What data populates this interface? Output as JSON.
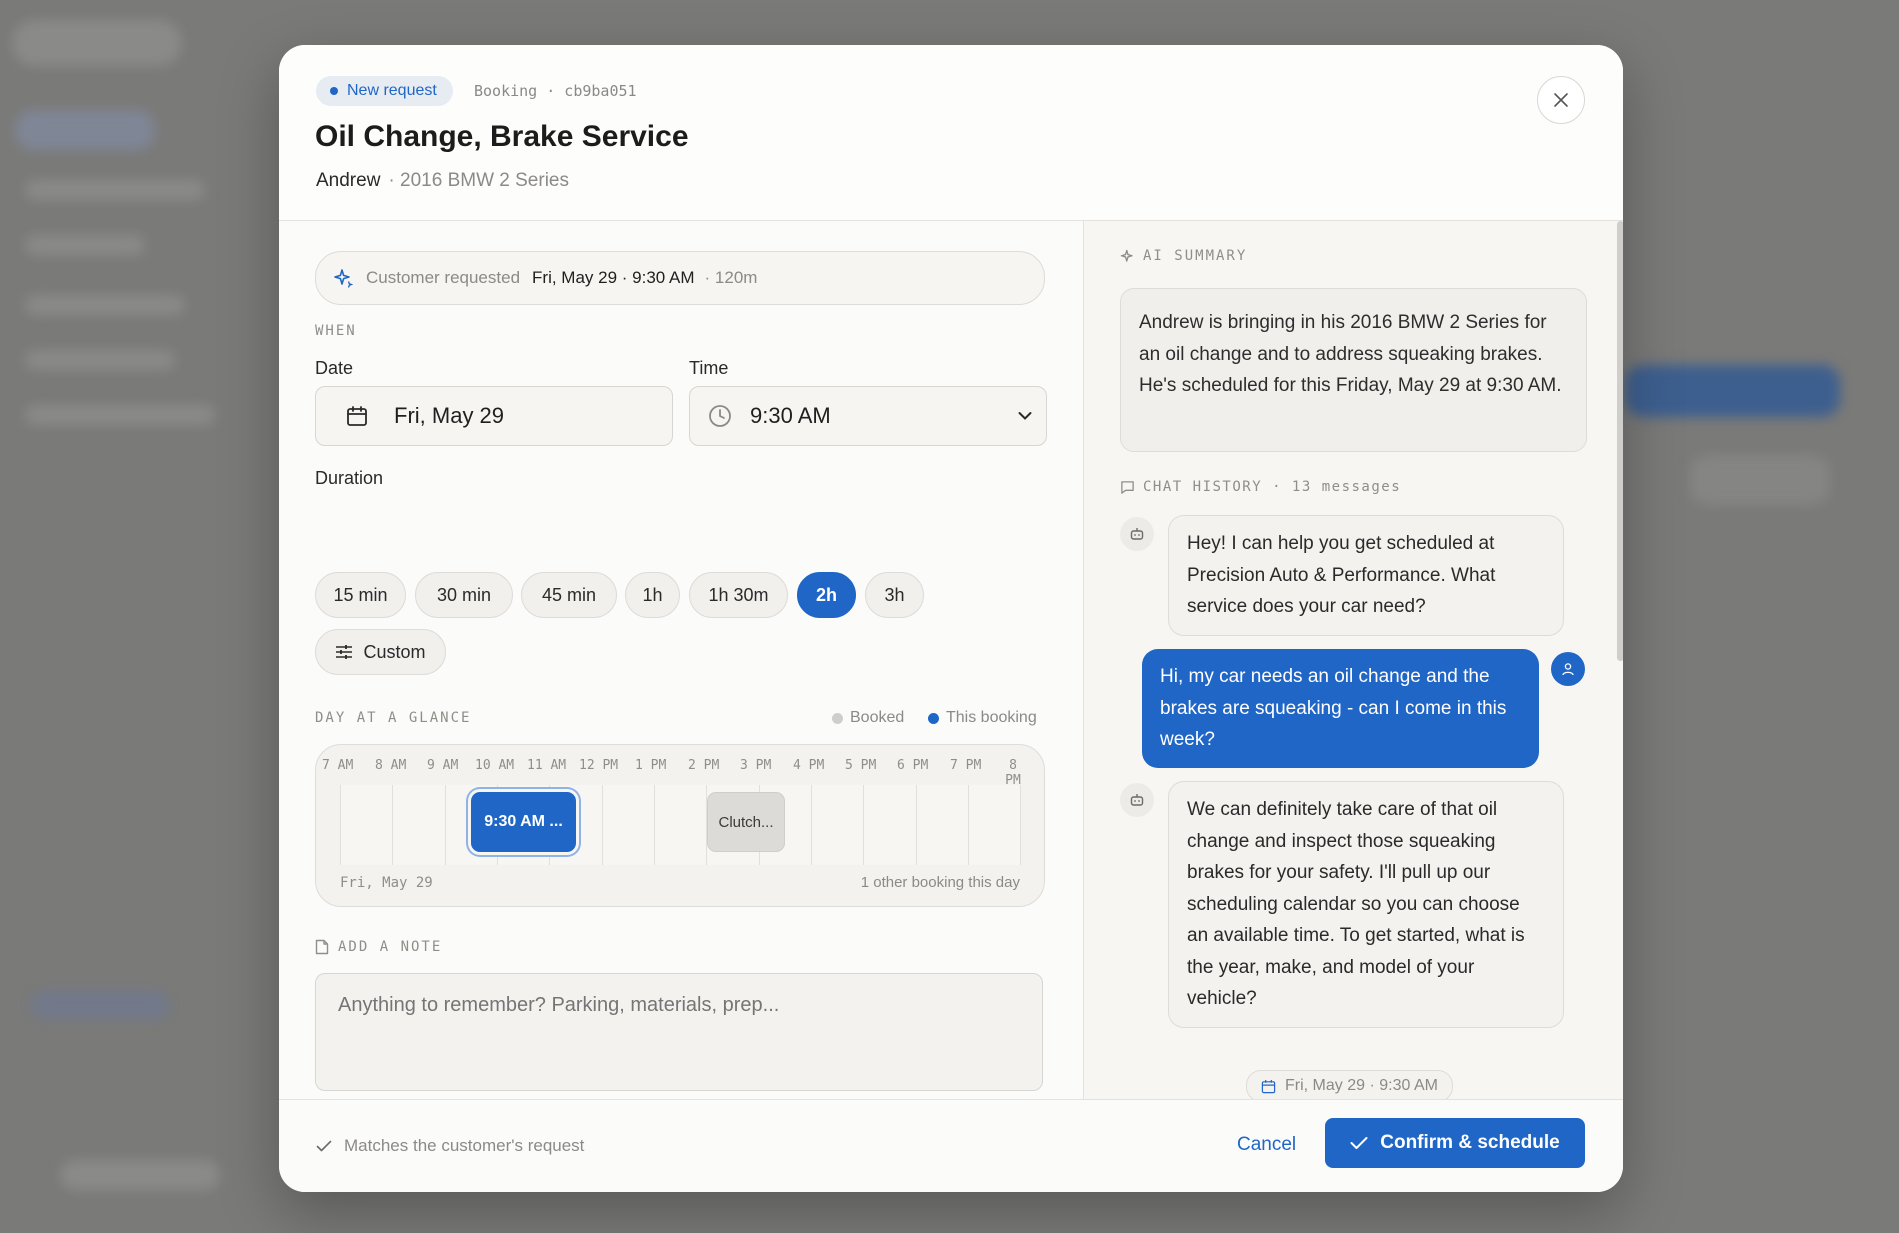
{
  "header": {
    "badge": "New request",
    "crumb": "Booking · cb9ba051",
    "title": "Oil Change, Brake Service",
    "customer": "Andrew",
    "vehicle": "· 2016 BMW 2 Series",
    "close_label": "×"
  },
  "request": {
    "label": "Customer requested",
    "when": "Fri, May 29 · 9:30 AM",
    "duration": "· 120m"
  },
  "when": {
    "section": "WHEN",
    "date_label": "Date",
    "date_value": "Fri, May 29",
    "time_label": "Time",
    "time_value": "9:30 AM",
    "duration_label": "Duration",
    "durations": [
      "15 min",
      "30 min",
      "45 min",
      "1h",
      "1h 30m",
      "2h",
      "3h"
    ],
    "selected_duration": "2h",
    "custom_label": "Custom"
  },
  "glance": {
    "section": "DAY AT A GLANCE",
    "legend_booked": "Booked",
    "legend_this": "This booking",
    "hours": [
      "7 AM",
      "8 AM",
      "9 AM",
      "10 AM",
      "11 AM",
      "12 PM",
      "1 PM",
      "2 PM",
      "3 PM",
      "4 PM",
      "5 PM",
      "6 PM",
      "7 PM",
      "8 PM"
    ],
    "this_booking": "9:30 AM ...",
    "booked_block": "Clutch...",
    "date": "Fri, May 29",
    "other_bookings": "1 other booking this day"
  },
  "note": {
    "section": "ADD A NOTE",
    "placeholder": "Anything to remember? Parking, materials, prep..."
  },
  "ai": {
    "section": "AI SUMMARY",
    "summary": "Andrew is bringing in his 2016 BMW 2 Series for an oil change and to address squeaking brakes. He's scheduled for this Friday, May 29 at 9:30 AM."
  },
  "chat": {
    "section": "CHAT HISTORY · 13 messages",
    "messages": [
      {
        "from": "bot",
        "text": "Hey! I can help you get scheduled at Precision Auto & Performance. What service does your car need?"
      },
      {
        "from": "user",
        "text": "Hi, my car needs an oil change and the brakes are squeaking - can I come in this week?"
      },
      {
        "from": "bot",
        "text": "We can definitely take care of that oil change and inspect those squeaking brakes for your safety. I'll pull up our scheduling calendar so you can choose an available time. To get started, what is the year, make, and model of your vehicle?"
      }
    ],
    "chip": "Fri, May 29 · 9:30 AM"
  },
  "footer": {
    "match": "Matches the customer's request",
    "cancel": "Cancel",
    "confirm": "Confirm & schedule"
  },
  "colors": {
    "accent": "#1f66c6",
    "booked": "#dcdbd8"
  }
}
